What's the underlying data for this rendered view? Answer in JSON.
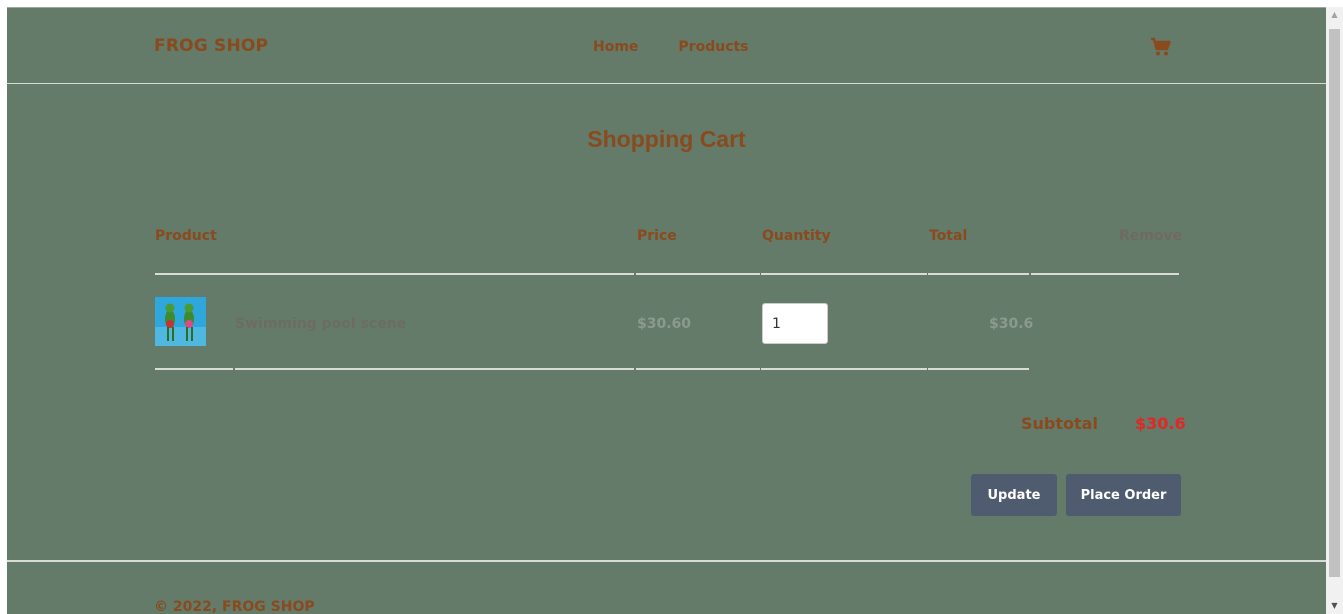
{
  "header": {
    "brand": "FROG SHOP",
    "nav": [
      {
        "label": "Home"
      },
      {
        "label": "Products"
      }
    ],
    "cart_icon": "shopping-cart-icon"
  },
  "page_title": "Shopping Cart",
  "table": {
    "headers": {
      "product": "Product",
      "price": "Price",
      "quantity": "Quantity",
      "total": "Total",
      "remove": "Remove"
    },
    "rows": [
      {
        "image_icon": "frog-product-thumbnail",
        "name": "Swimming pool scene",
        "price": "$30.60",
        "quantity": "1",
        "total": "$30.6"
      }
    ]
  },
  "summary": {
    "subtotal_label": "Subtotal",
    "subtotal_value": "$30.6"
  },
  "buttons": {
    "update": "Update",
    "place_order": "Place Order"
  },
  "footer": {
    "copyright": "© 2022, FROG SHOP"
  },
  "colors": {
    "background": "#637b68",
    "accent_text": "#8a4a1e",
    "subtotal_value": "#e32626",
    "button": "#4f5b6e"
  }
}
